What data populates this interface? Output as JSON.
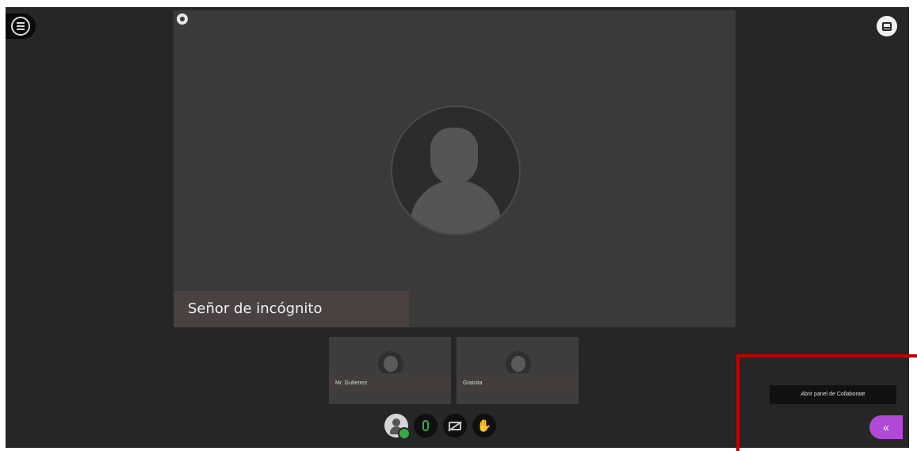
{
  "session": {
    "speaker_name": "Señor de incógnito"
  },
  "participants": [
    {
      "name": "Mr. Gutierrez"
    },
    {
      "name": "Grainita"
    }
  ],
  "panel": {
    "tooltip": "Abrir panel de Collaborate",
    "open_glyph": "«"
  },
  "toolbar": {
    "hand_glyph": "✋"
  },
  "icons": [
    "menu-icon",
    "closed-caption-icon",
    "layout-icon",
    "avatar-icon",
    "microphone-icon",
    "camera-off-icon",
    "raise-hand-icon",
    "chevron-left-icon"
  ],
  "colors": {
    "background": "#262626",
    "stage": "#3a3a3a",
    "accent": "#b04ad6",
    "mic_active": "#3aa845",
    "highlight": "#c00000"
  }
}
